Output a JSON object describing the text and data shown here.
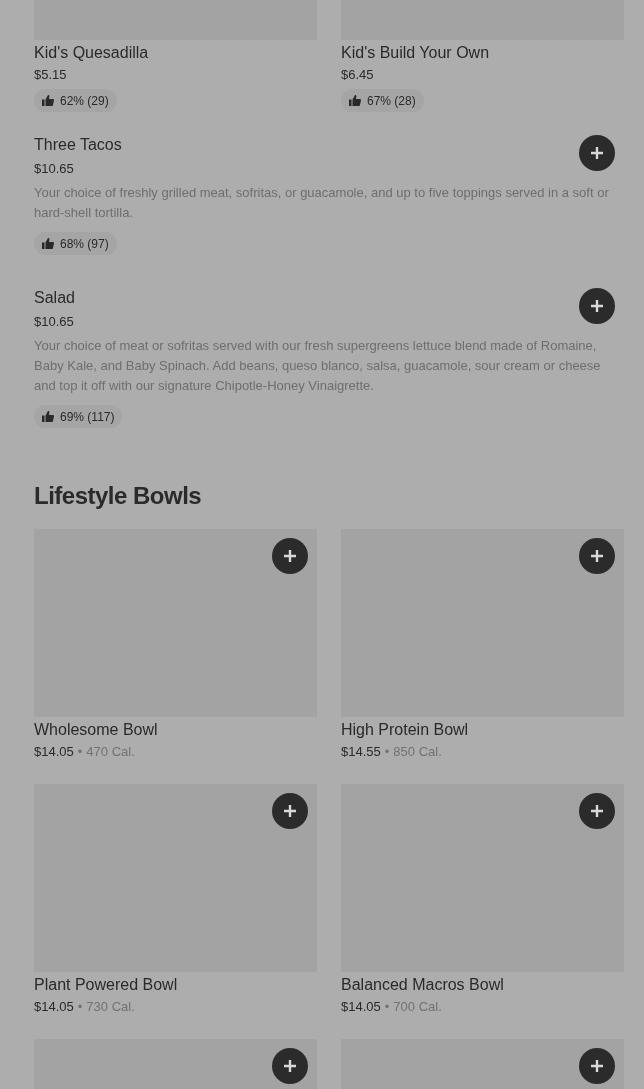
{
  "top_items": [
    {
      "name": "Kid's Quesadilla",
      "price": "$5.15",
      "rating": "62% (29)"
    },
    {
      "name": "Kid's Build Your Own",
      "price": "$6.45",
      "rating": "67% (28)"
    }
  ],
  "items": [
    {
      "name": "Three Tacos",
      "price": "$10.65",
      "description": "Your choice of freshly grilled meat, sofritas, or guacamole, and up to five toppings served in a soft or hard-shell tortilla.",
      "rating": "68% (97)"
    },
    {
      "name": "Salad",
      "price": "$10.65",
      "description": "Your choice of meat or sofritas served with our fresh supergreens lettuce blend made of Romaine, Baby Kale, and Baby Spinach. Add beans, queso blanco, salsa, guacamole, sour cream or cheese and top it off with our signature Chipotle-Honey Vinaigrette.",
      "rating": "69% (117)"
    }
  ],
  "section": {
    "title": "Lifestyle Bowls",
    "bowls": [
      {
        "kind": "full",
        "name": "Wholesome Bowl",
        "price": "$14.05",
        "separator": "•",
        "calories": "470 Cal."
      },
      {
        "kind": "full",
        "name": "High Protein Bowl",
        "price": "$14.55",
        "separator": "•",
        "calories": "850 Cal."
      },
      {
        "kind": "full",
        "name": "Plant Powered Bowl",
        "price": "$14.05",
        "separator": "•",
        "calories": "730 Cal."
      },
      {
        "kind": "full",
        "name": "Balanced Macros Bowl",
        "price": "$14.05",
        "separator": "•",
        "calories": "700 Cal."
      },
      {
        "kind": "partial"
      },
      {
        "kind": "partial"
      }
    ]
  }
}
